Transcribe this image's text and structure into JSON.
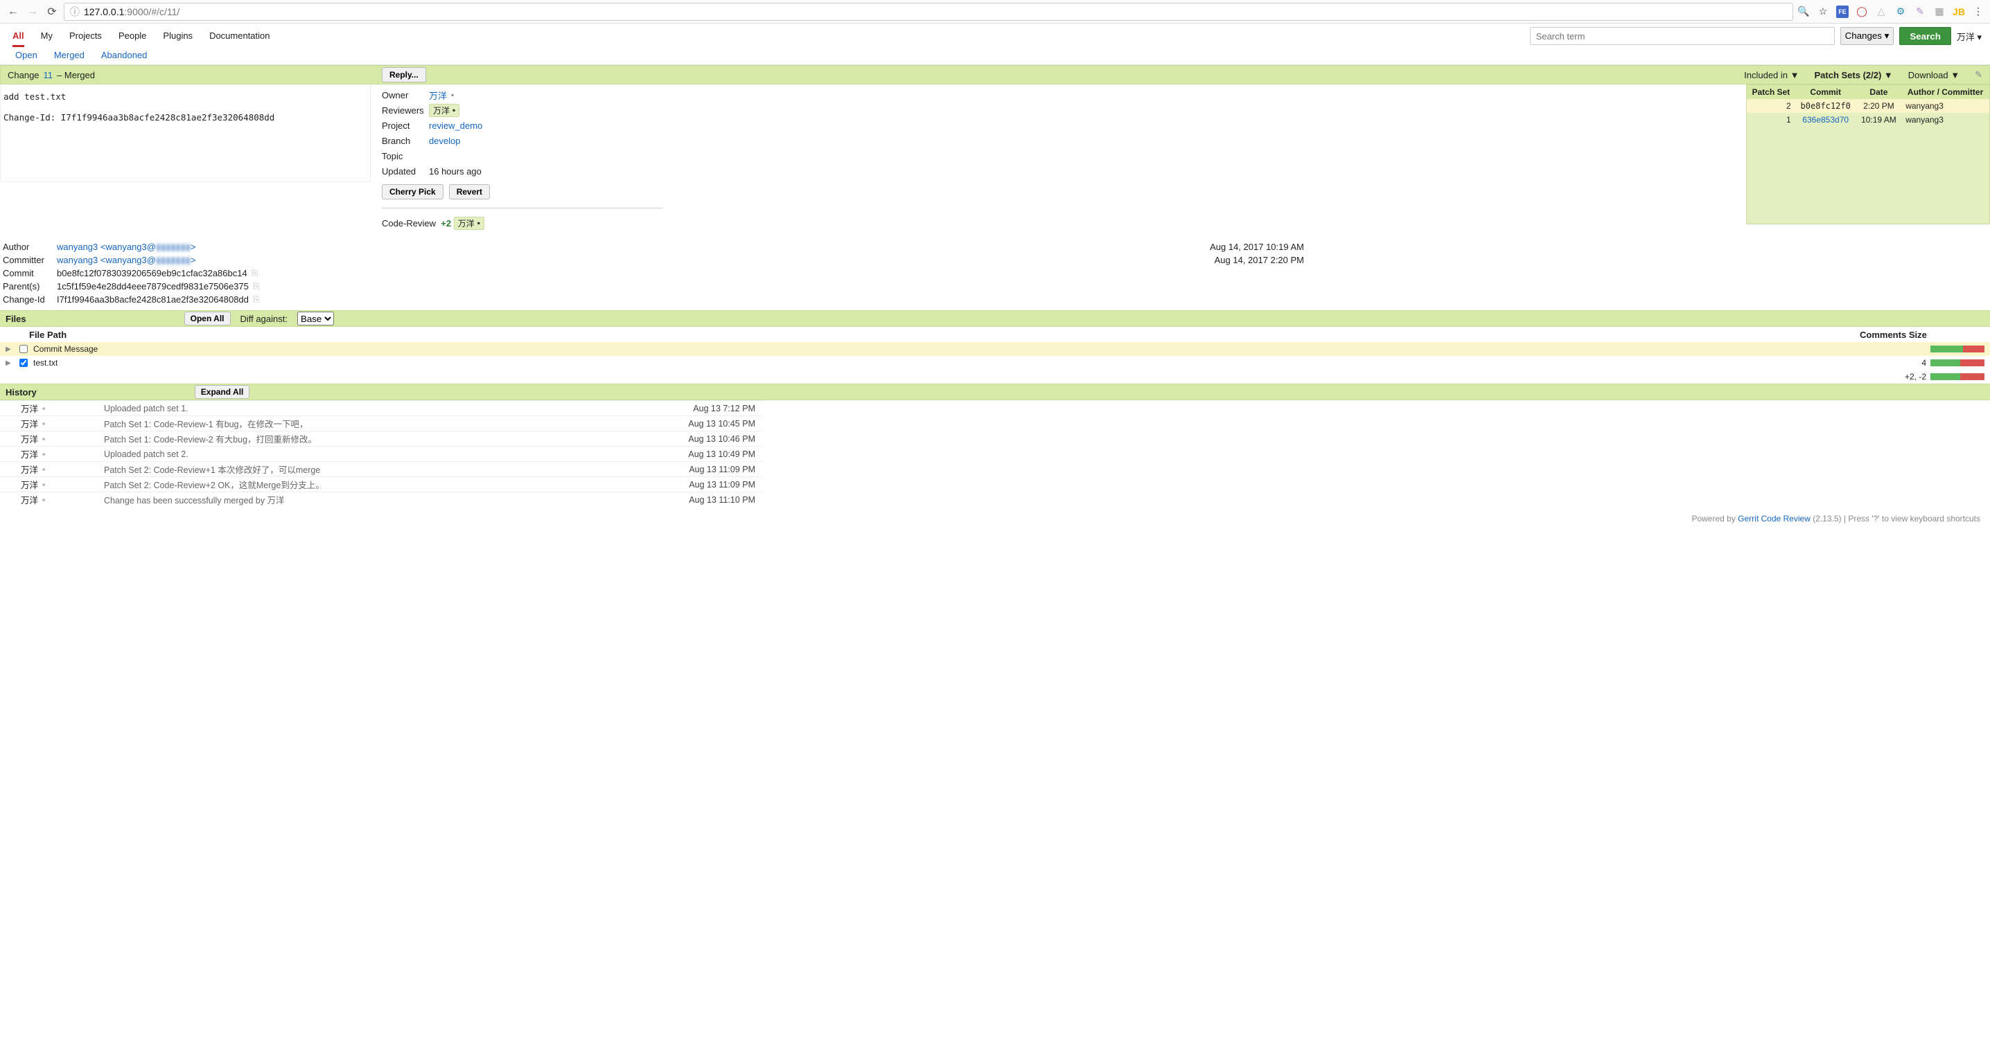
{
  "browser": {
    "url_host": "127.0.0.1",
    "url_rest": ":9000/#/c/11/"
  },
  "nav": {
    "tabs": [
      "All",
      "My",
      "Projects",
      "People",
      "Plugins",
      "Documentation"
    ],
    "subtabs": [
      "Open",
      "Merged",
      "Abandoned"
    ],
    "search_placeholder": "Search term",
    "changes_label": "Changes",
    "search_btn": "Search",
    "user": "万洋"
  },
  "header": {
    "change_word": "Change",
    "change_no": "11",
    "status": "– Merged",
    "reply_btn": "Reply...",
    "included_in": "Included in ▼",
    "patch_sets": "Patch Sets (2/2) ▼",
    "download": "Download ▼"
  },
  "commit_msg": "add test.txt\n\nChange-Id: I7f1f9946aa3b8acfe2428c81ae2f3e32064808dd",
  "info": {
    "owner_lbl": "Owner",
    "owner": "万洋",
    "reviewers_lbl": "Reviewers",
    "reviewer": "万洋",
    "project_lbl": "Project",
    "project": "review_demo",
    "branch_lbl": "Branch",
    "branch": "develop",
    "topic_lbl": "Topic",
    "updated_lbl": "Updated",
    "updated": "16 hours ago",
    "cherry_btn": "Cherry Pick",
    "revert_btn": "Revert",
    "code_review_lbl": "Code-Review",
    "code_review_score": "+2",
    "code_review_user": "万洋"
  },
  "patch_table": {
    "hdr": [
      "Patch Set",
      "Commit",
      "Date",
      "Author / Committer"
    ],
    "rows": [
      {
        "n": "2",
        "commit": "b0e8fc12f0",
        "date": "2:20 PM",
        "who": "wanyang3",
        "sel": true,
        "link": false
      },
      {
        "n": "1",
        "commit": "636e853d70",
        "date": "10:19 AM",
        "who": "wanyang3",
        "sel": false,
        "link": true
      }
    ]
  },
  "meta": {
    "author_lbl": "Author",
    "author": "wanyang3 <wanyang3@",
    "author_date": "Aug 14, 2017 10:19 AM",
    "committer_lbl": "Committer",
    "committer": "wanyang3 <wanyang3@",
    "committer_date": "Aug 14, 2017 2:20 PM",
    "commit_lbl": "Commit",
    "commit": "b0e8fc12f0783039206569eb9c1cfac32a86bc14",
    "parents_lbl": "Parent(s)",
    "parents": "1c5f1f59e4e28dd4eee7879cedf9831e7506e375",
    "changeid_lbl": "Change-Id",
    "changeid": "I7f1f9946aa3b8acfe2428c81ae2f3e32064808dd"
  },
  "files": {
    "title": "Files",
    "open_all": "Open All",
    "diff_label": "Diff against:",
    "diff_base": "Base",
    "hdr_path": "File Path",
    "hdr_comments": "Comments",
    "hdr_size": "Size",
    "rows": [
      {
        "name": "Commit Message",
        "checked": false,
        "size": "",
        "sel": true,
        "g": 60,
        "r": 40
      },
      {
        "name": "test.txt",
        "checked": true,
        "size": "4",
        "sel": false,
        "g": 55,
        "r": 45
      }
    ],
    "total": "+2, -2"
  },
  "history": {
    "title": "History",
    "expand": "Expand All",
    "rows": [
      {
        "who": "万洋",
        "msg": "Uploaded patch set 1.",
        "when": "Aug 13 7:12 PM"
      },
      {
        "who": "万洋",
        "msg": "Patch Set 1: Code-Review-1 有bug，在修改一下吧，",
        "when": "Aug 13 10:45 PM"
      },
      {
        "who": "万洋",
        "msg": "Patch Set 1: Code-Review-2 有大bug，打回重新修改。",
        "when": "Aug 13 10:46 PM"
      },
      {
        "who": "万洋",
        "msg": "Uploaded patch set 2.",
        "when": "Aug 13 10:49 PM"
      },
      {
        "who": "万洋",
        "msg": "Patch Set 2: Code-Review+1 本次修改好了，可以merge",
        "when": "Aug 13 11:09 PM"
      },
      {
        "who": "万洋",
        "msg": "Patch Set 2: Code-Review+2 OK，这就Merge到分支上。",
        "when": "Aug 13 11:09 PM"
      },
      {
        "who": "万洋",
        "msg": "Change has been successfully merged by 万洋",
        "when": "Aug 13 11:10 PM"
      }
    ]
  },
  "footer": {
    "powered": "Powered by ",
    "link": "Gerrit Code Review",
    "ver": " (2.13.5) | Press '?' to view keyboard shortcuts"
  }
}
